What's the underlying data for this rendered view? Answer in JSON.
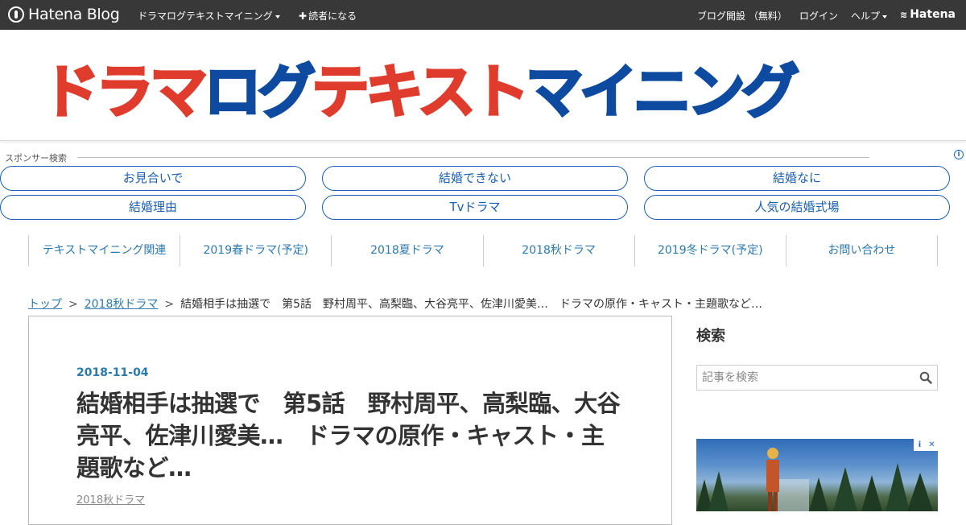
{
  "topbar": {
    "brand": "Hatena Blog",
    "blog_menu": "ドラマログテキストマイニング",
    "subscribe": "読者になる",
    "open_blog": "ブログ開設 （無料）",
    "login": "ログイン",
    "help": "ヘルプ",
    "hatena": "Hatena"
  },
  "banner": {
    "title_part1": "ドラマ",
    "title_part2": "ログ",
    "title_part3": "テキスト",
    "title_part4": "マイニング",
    "accent_red": "#e03c2e",
    "accent_blue": "#0d4aa0"
  },
  "sponsor": {
    "label": "スポンサー検索",
    "pills": [
      "お見合いで",
      "結婚できない",
      "結婚なに",
      "結婚理由",
      "Tvドラマ",
      "人気の結婚式場"
    ]
  },
  "nav": {
    "items": [
      "テキストマイニング関連",
      "2019春ドラマ(予定)",
      "2018夏ドラマ",
      "2018秋ドラマ",
      "2019冬ドラマ(予定)",
      "お問い合わせ"
    ]
  },
  "breadcrumb": {
    "top": "トップ",
    "category": "2018秋ドラマ",
    "current": "結婚相手は抽選で　第5話　野村周平、高梨臨、大谷亮平、佐津川愛美…　ドラマの原作・キャスト・主題歌など…"
  },
  "article": {
    "date": "2018-11-04",
    "title": "結婚相手は抽選で　第5話　野村周平、高梨臨、大谷亮平、佐津川愛美…　ドラマの原作・キャスト・主題歌など…",
    "category": "2018秋ドラマ"
  },
  "sidebar": {
    "search_heading": "検索",
    "search_placeholder": "記事を検索"
  }
}
